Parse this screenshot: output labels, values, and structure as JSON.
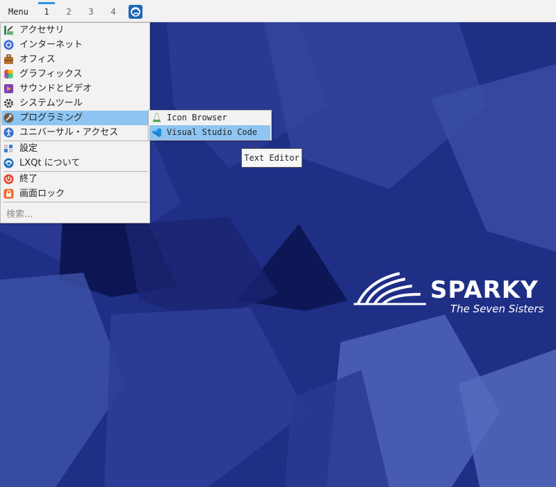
{
  "panel": {
    "menu_label": "Menu",
    "workspaces": [
      "1",
      "2",
      "3",
      "4"
    ],
    "active_workspace": "1",
    "taskbar_icon": "sparky-swirl-icon"
  },
  "main_menu": {
    "items": [
      {
        "label": "アクセサリ",
        "icon": "accessories-icon"
      },
      {
        "label": "インターネット",
        "icon": "internet-icon"
      },
      {
        "label": "オフィス",
        "icon": "office-icon"
      },
      {
        "label": "グラフィックス",
        "icon": "graphics-icon"
      },
      {
        "label": "サウンドとビデオ",
        "icon": "sound-video-icon"
      },
      {
        "label": "システムツール",
        "icon": "system-tools-icon"
      },
      {
        "label": "プログラミング",
        "icon": "programming-icon"
      },
      {
        "label": "ユニバーサル・アクセス",
        "icon": "universal-access-icon"
      },
      {
        "label": "設定",
        "icon": "settings-icon"
      },
      {
        "label": "LXQt について",
        "icon": "lxqt-icon"
      },
      {
        "label": "終了",
        "icon": "power-icon"
      },
      {
        "label": "画面ロック",
        "icon": "lock-icon"
      }
    ],
    "highlighted": "プログラミング",
    "search_placeholder": "検索..."
  },
  "sub_menu": {
    "items": [
      {
        "label": "Icon Browser",
        "icon": "flask-icon"
      },
      {
        "label": "Visual Studio Code",
        "icon": "vscode-icon"
      }
    ],
    "highlighted": "Visual Studio Code"
  },
  "tooltip": {
    "text": "Text Editor"
  },
  "logo": {
    "wordmark": "SPARKY",
    "tagline": "The Seven Sisters"
  },
  "colors": {
    "wallpaper": "#1f2f86",
    "highlight": "#8ec5f2",
    "active_workspace_bar": "#2f8fe0"
  }
}
